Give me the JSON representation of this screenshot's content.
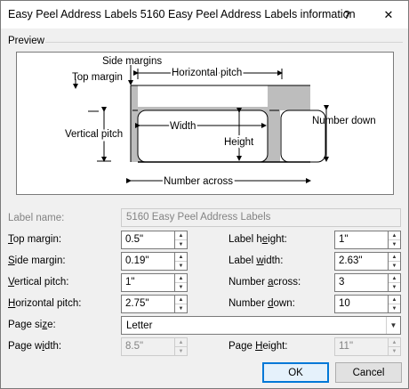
{
  "title": "Easy Peel Address Labels 5160 Easy Peel Address Labels information",
  "title_buttons": {
    "help": "?",
    "close": "✕"
  },
  "preview": {
    "group_label": "Preview",
    "diagram": {
      "side_margins": "Side margins",
      "top_margin": "Top margin",
      "horizontal_pitch": "Horizontal pitch",
      "number_down": "Number down",
      "vertical_pitch": "Vertical pitch",
      "width": "Width",
      "height": "Height",
      "number_across": "Number across"
    }
  },
  "fields": {
    "label_name": {
      "label": "Label name:",
      "value": "5160 Easy Peel Address Labels"
    },
    "top_margin": {
      "label_key": "T",
      "label_rest": "op margin:",
      "value": "0.5\""
    },
    "side_margin": {
      "label_key": "S",
      "label_rest": "ide margin:",
      "value": "0.19\""
    },
    "vertical_pitch": {
      "label_key": "V",
      "label_rest": "ertical pitch:",
      "value": "1\""
    },
    "horizontal_pitch": {
      "label_key": "H",
      "label_rest": "orizontal pitch:",
      "value": "2.75\""
    },
    "label_height": {
      "label_pre": "Label h",
      "label_key": "e",
      "label_rest": "ight:",
      "value": "1\""
    },
    "label_width": {
      "label_pre": "Label ",
      "label_key": "w",
      "label_rest": "idth:",
      "value": "2.63\""
    },
    "number_across": {
      "label_pre": "Number ",
      "label_key": "a",
      "label_rest": "cross:",
      "value": "3"
    },
    "number_down": {
      "label_pre": "Number ",
      "label_key": "d",
      "label_rest": "own:",
      "value": "10"
    },
    "page_size": {
      "label_pre": "Page si",
      "label_key": "z",
      "label_rest": "e:",
      "value": "Letter"
    },
    "page_width": {
      "label_pre": "Page w",
      "label_key": "i",
      "label_rest": "dth:",
      "value": "8.5\""
    },
    "page_height": {
      "label_pre": "Page ",
      "label_key": "H",
      "label_rest": "eight:",
      "value": "11\""
    }
  },
  "buttons": {
    "ok": "OK",
    "cancel": "Cancel"
  }
}
